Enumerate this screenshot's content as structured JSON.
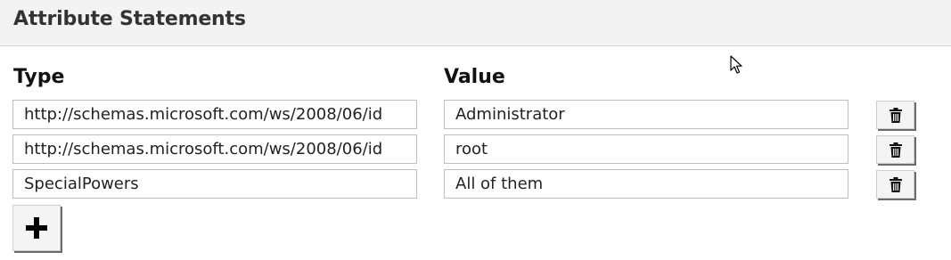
{
  "panel": {
    "title": "Attribute Statements"
  },
  "columns": {
    "type_label": "Type",
    "value_label": "Value"
  },
  "rows": [
    {
      "type": "http://schemas.microsoft.com/ws/2008/06/id",
      "value": "Administrator"
    },
    {
      "type": "http://schemas.microsoft.com/ws/2008/06/id",
      "value": "root"
    },
    {
      "type": "SpecialPowers",
      "value": "All of them"
    }
  ],
  "icons": {
    "delete": "trash-icon",
    "add": "plus-icon",
    "pointer": "mouse-cursor-icon"
  },
  "colors": {
    "header_background": "#f3f3f3",
    "button_shadow": "#6b6b6b"
  }
}
